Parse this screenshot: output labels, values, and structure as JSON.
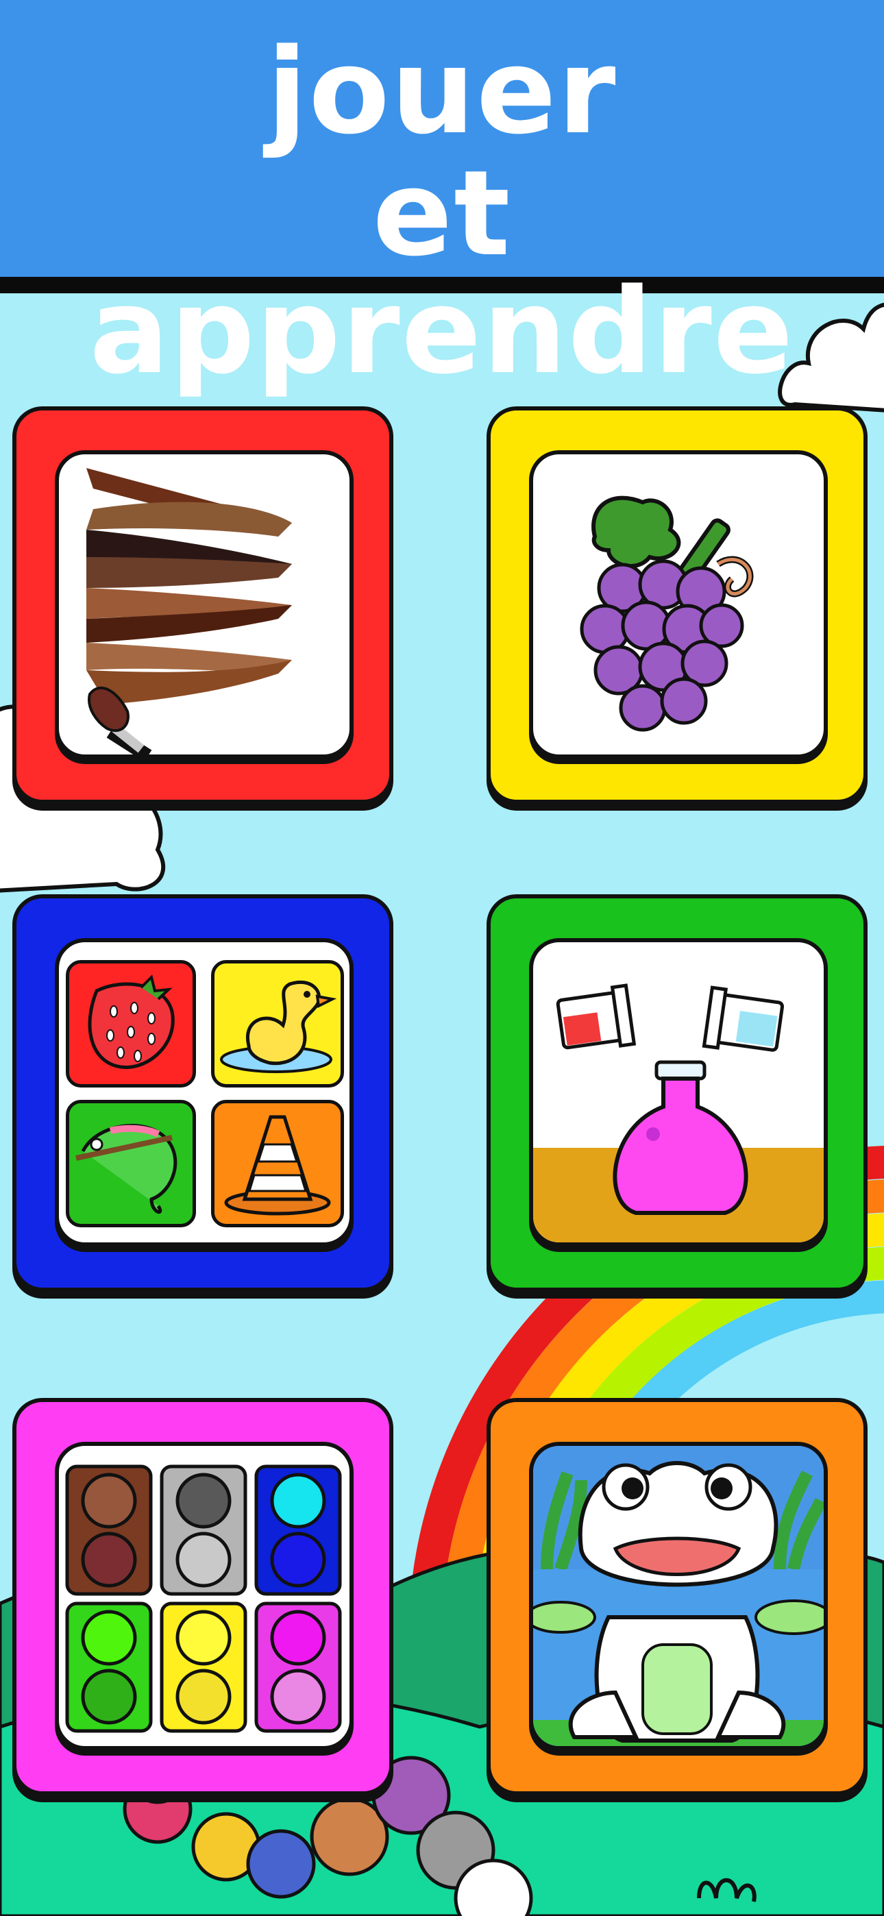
{
  "header": {
    "title_line1": "jouer",
    "title_line2": "et apprendre",
    "background": "#3d93ea"
  },
  "cards": [
    {
      "name": "color-mixing-brush-game",
      "frame_color": "#ff2a2a",
      "icon": "paintbrush-stripes-icon"
    },
    {
      "name": "coloring-grapes-game",
      "frame_color": "#ffe600",
      "icon": "grapes-icon"
    },
    {
      "name": "picture-matching-game",
      "frame_color": "#1226e8",
      "icon": "strawberry-duck-chameleon-cone-icon"
    },
    {
      "name": "potion-mixing-game",
      "frame_color": "#19c21c",
      "icon": "flask-icon"
    },
    {
      "name": "color-sorting-game",
      "frame_color": "#ff3df2",
      "icon": "color-dots-icon"
    },
    {
      "name": "frog-coloring-game",
      "frame_color": "#ff8a12",
      "icon": "frog-icon"
    }
  ],
  "colors": {
    "sky": "#a9eef8",
    "hill": "#14c97e"
  }
}
